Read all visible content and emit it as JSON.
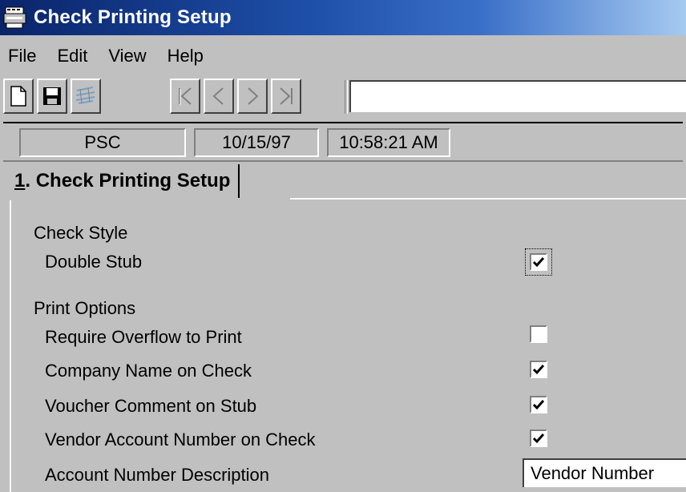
{
  "window": {
    "title": "Check Printing Setup",
    "icon": "check-printer-icon"
  },
  "menu": {
    "items": [
      "File",
      "Edit",
      "View",
      "Help"
    ]
  },
  "toolbar": {
    "buttons": [
      "new-document-icon",
      "save-disk-icon",
      "form-icon",
      "first-record-icon",
      "previous-record-icon",
      "next-record-icon",
      "last-record-icon"
    ],
    "search_value": ""
  },
  "status": {
    "company": "PSC",
    "date": "10/15/97",
    "time": "10:58:21 AM"
  },
  "tabs": [
    {
      "hotkey": "1",
      "label": ". Check Printing Setup"
    }
  ],
  "form": {
    "check_style_heading": "Check Style",
    "double_stub_label": "Double Stub",
    "double_stub_checked": true,
    "print_options_heading": "Print Options",
    "require_overflow_label": "Require Overflow to Print",
    "require_overflow_checked": false,
    "company_name_label": "Company Name on Check",
    "company_name_checked": true,
    "voucher_comment_label": "Voucher Comment on Stub",
    "voucher_comment_checked": true,
    "vendor_account_label": "Vendor Account Number on Check",
    "vendor_account_checked": true,
    "account_desc_label": "Account Number Description",
    "account_desc_value": "Vendor Number"
  }
}
